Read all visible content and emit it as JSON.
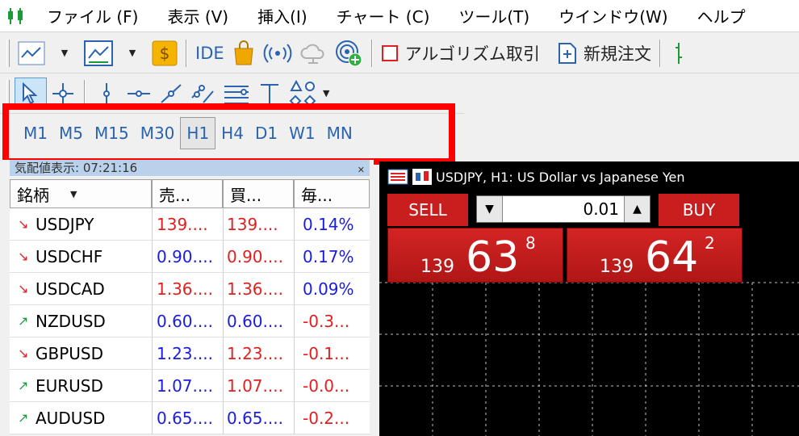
{
  "menu": [
    "ファイル (F)",
    "表示 (V)",
    "挿入(I)",
    "チャート (C)",
    "ツール(T)",
    "ウインドウ(W)",
    "ヘルプ"
  ],
  "toolbar": {
    "ide_label": "IDE",
    "algo_label": "アルゴリズム取引",
    "new_order_label": "新規注文"
  },
  "timeframes": [
    "M1",
    "M5",
    "M15",
    "M30",
    "H1",
    "H4",
    "D1",
    "W1",
    "MN"
  ],
  "active_timeframe": "H1",
  "market_watch": {
    "title": "気配値表示: 07:21:16",
    "headers": [
      "銘柄",
      "売...",
      "買...",
      "毎..."
    ],
    "rows": [
      {
        "symbol": "USDJPY",
        "dir": "down",
        "bid": "139....",
        "ask": "139....",
        "change": "0.14%"
      },
      {
        "symbol": "USDCHF",
        "dir": "down",
        "bid": "0.90....",
        "ask": "0.90....",
        "change": "0.17%"
      },
      {
        "symbol": "USDCAD",
        "dir": "down",
        "bid": "1.36....",
        "ask": "1.36....",
        "change": "0.09%"
      },
      {
        "symbol": "NZDUSD",
        "dir": "up",
        "bid": "0.60....",
        "ask": "0.60....",
        "change": "-0.3..."
      },
      {
        "symbol": "GBPUSD",
        "dir": "down",
        "bid": "1.23....",
        "ask": "1.23....",
        "change": "-0.1..."
      },
      {
        "symbol": "EURUSD",
        "dir": "up",
        "bid": "1.07....",
        "ask": "1.07....",
        "change": "-0.0..."
      },
      {
        "symbol": "AUDUSD",
        "dir": "up",
        "bid": "0.65....",
        "ask": "0.65....",
        "change": "-0.2..."
      }
    ]
  },
  "chart": {
    "title": "USDJPY, H1: US Dollar vs Japanese Yen",
    "sell_label": "SELL",
    "buy_label": "BUY",
    "lot": "0.01",
    "sell_price": {
      "prefix": "139",
      "big": "63",
      "sup": "8"
    },
    "buy_price": {
      "prefix": "139",
      "big": "64",
      "sup": "2"
    }
  },
  "colors": {
    "accent": "#2a64b0",
    "sell": "#c81e1e",
    "highlight": "#ff0000"
  }
}
